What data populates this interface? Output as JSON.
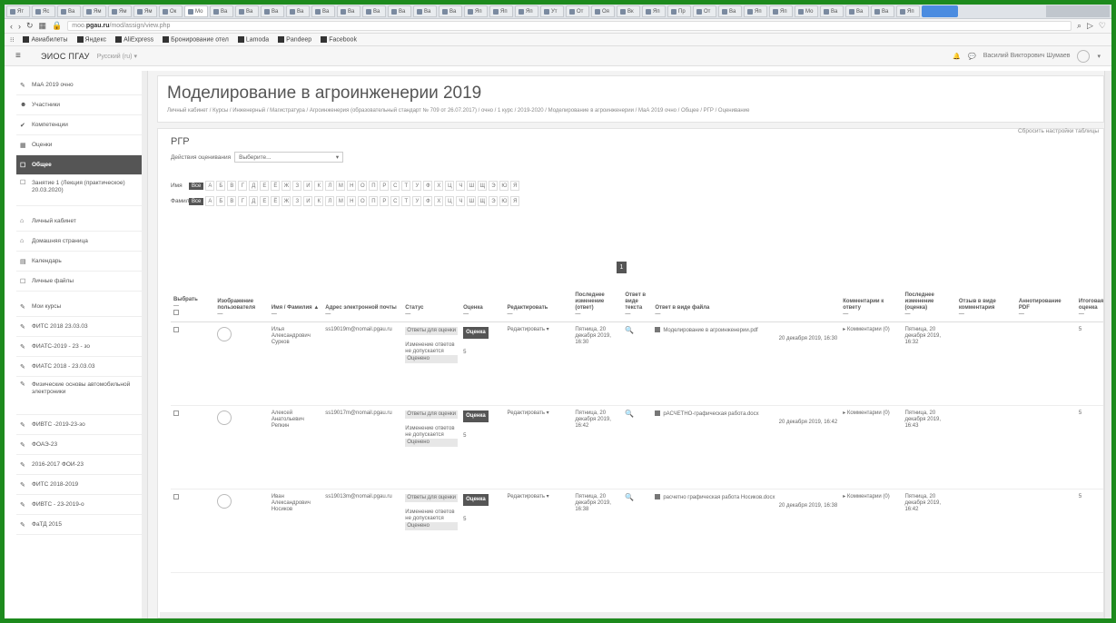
{
  "browser": {
    "tabs": [
      "Ят",
      "Яс",
      "Ва",
      "Ям",
      "Ям",
      "Ям",
      "Ок",
      "Мо",
      "Ва",
      "Ва",
      "Ва",
      "Ва",
      "Ва",
      "Ва",
      "Ва",
      "Ва",
      "Ва",
      "Ва",
      "Яп",
      "Яп",
      "Яп",
      "Ут",
      "От",
      "Оя",
      "Вк",
      "Яп",
      "Пр",
      "От",
      "Ва",
      "Яп",
      "Яп",
      "Мо",
      "Ва",
      "Ва",
      "Ва",
      "Яп"
    ],
    "active_tab": 7,
    "url_host": "pgau.ru",
    "url_pre": "moo.",
    "url_path": "/mod/assign/view.php",
    "bookmarks": [
      "Авиабилеты",
      "Яндекс",
      "AliExpress",
      "Бронирование отел",
      "Lamoda",
      "Pandeep",
      "Facebook"
    ]
  },
  "navbar": {
    "menu_icon": "hamburger-icon",
    "brand": "ЭИОС ПГАУ",
    "language": "Русский (ru) ▾",
    "user_name": "Василий Викторович Шумаев"
  },
  "sidebar": {
    "items": [
      {
        "icon": "✎",
        "label": "МаА 2019 очно"
      },
      {
        "icon": "☻",
        "label": "Участники"
      },
      {
        "icon": "✔",
        "label": "Компетенции"
      },
      {
        "icon": "▦",
        "label": "Оценки"
      },
      {
        "icon": "☐",
        "label": "Общее",
        "active": true
      },
      {
        "icon": "☐",
        "label": "Занятие 1 (Лекция (практическое) 20.03.2020)",
        "tall": true
      },
      {
        "icon": "⌂",
        "label": "Личный кабинет"
      },
      {
        "icon": "⌂",
        "label": "Домашняя страница"
      },
      {
        "icon": "▤",
        "label": "Календарь"
      },
      {
        "icon": "☐",
        "label": "Личные файлы"
      },
      {
        "icon": "✎",
        "label": "Мои курсы"
      },
      {
        "icon": "✎",
        "label": "ФИТС 2018 23.03.03"
      },
      {
        "icon": "✎",
        "label": "ФИАТС-2019 - 23 - зо"
      },
      {
        "icon": "✎",
        "label": "ФИАТС 2018 - 23.03.03"
      },
      {
        "icon": "✎",
        "label": "Физические основы автомобильной электроники",
        "taller": true
      },
      {
        "icon": "✎",
        "label": "ФИВТС -2019-23-зо"
      },
      {
        "icon": "✎",
        "label": "ФОАЭ-23"
      },
      {
        "icon": "✎",
        "label": "2016-2017 ФОИ-23"
      },
      {
        "icon": "✎",
        "label": "ФИТС 2018-2019"
      },
      {
        "icon": "✎",
        "label": "ФИВТС - 23-2019-о"
      },
      {
        "icon": "✎",
        "label": "ФаТД 2015"
      }
    ]
  },
  "page": {
    "title": "Моделирование в агроинженерии 2019",
    "breadcrumb": "Личный кабинет / Курсы / Инженерный / Магистратура / Агроинженерия (образовательный стандарт № 709 от 26.07.2017) / очно / 1 курс / 2019-2020 / Моделирование в агроинженерии / МаА 2019 очно / Общее / РГР / Оценивание"
  },
  "assignment": {
    "section_title": "РГР",
    "grading_action_label": "Действия оценивания",
    "grading_action_value": "Выберите...",
    "reset_table": "Сбросить настройки таблицы",
    "name_label": "Имя",
    "surname_label": "Фамилия",
    "all_label": "Все",
    "letters": [
      "А",
      "Б",
      "В",
      "Г",
      "Д",
      "Е",
      "Ё",
      "Ж",
      "З",
      "И",
      "К",
      "Л",
      "М",
      "Н",
      "О",
      "П",
      "Р",
      "С",
      "Т",
      "У",
      "Ф",
      "Х",
      "Ц",
      "Ч",
      "Ш",
      "Щ",
      "Э",
      "Ю",
      "Я"
    ],
    "page_number": "1"
  },
  "table": {
    "headers": [
      "Выбрать",
      "Изображение пользователя",
      "Имя / Фамилия ▲",
      "Адрес электронной почты",
      "Статус",
      "Оценка",
      "Редактировать",
      "Последнее изменение (ответ)",
      "Ответ в виде текста",
      "Ответ в виде файла",
      "Комментарии к ответу",
      "Последнее изменение (оценка)",
      "Отзыв в виде комментария",
      "Аннотирование PDF",
      "Итоговая оценка"
    ],
    "rows": [
      {
        "name": "Илья Александрович Сурков",
        "email": "ss19019m@nomail.pgau.ru",
        "status": "Ответы для оценки",
        "status_note": "Изменение ответов не допускается",
        "status_graded": "Оценено",
        "grade_label": "Оценка",
        "grade_value": "5",
        "edit": "Редактировать ▾",
        "modified": "Пятница, 20 декабря 2019, 16:30",
        "file": "Моделирование в агроинженерии.pdf",
        "file_date": "20 декабря 2019, 16:30",
        "comments": "▸ Комментарии (0)",
        "grade_modified": "Пятница, 20 декабря 2019, 16:32",
        "final": "5"
      },
      {
        "name": "Алексей Анатольевич Репкин",
        "email": "ss19017m@nomail.pgau.ru",
        "status": "Ответы для оценки",
        "status_note": "Изменение ответов не допускается",
        "status_graded": "Оценено",
        "grade_label": "Оценка",
        "grade_value": "5",
        "edit": "Редактировать ▾",
        "modified": "Пятница, 20 декабря 2019, 16:42",
        "file": "рАСЧЕТНО-графическая работа.docx",
        "file_date": "20 декабря 2019, 16:42",
        "comments": "▸ Комментарии (0)",
        "grade_modified": "Пятница, 20 декабря 2019, 16:43",
        "final": "5"
      },
      {
        "name": "Иван Александрович Носиков",
        "email": "ss19013m@nomail.pgau.ru",
        "status": "Ответы для оценки",
        "status_note": "Изменение ответов не допускается",
        "status_graded": "Оценено",
        "grade_label": "Оценка",
        "grade_value": "5",
        "edit": "Редактировать ▾",
        "modified": "Пятница, 20 декабря 2019, 16:38",
        "file": "расчетно графическая работа Носиков.docx",
        "file_date": "20 декабря 2019, 16:38",
        "comments": "▸ Комментарии (0)",
        "grade_modified": "Пятница, 20 декабря 2019, 16:42",
        "final": "5"
      }
    ]
  }
}
